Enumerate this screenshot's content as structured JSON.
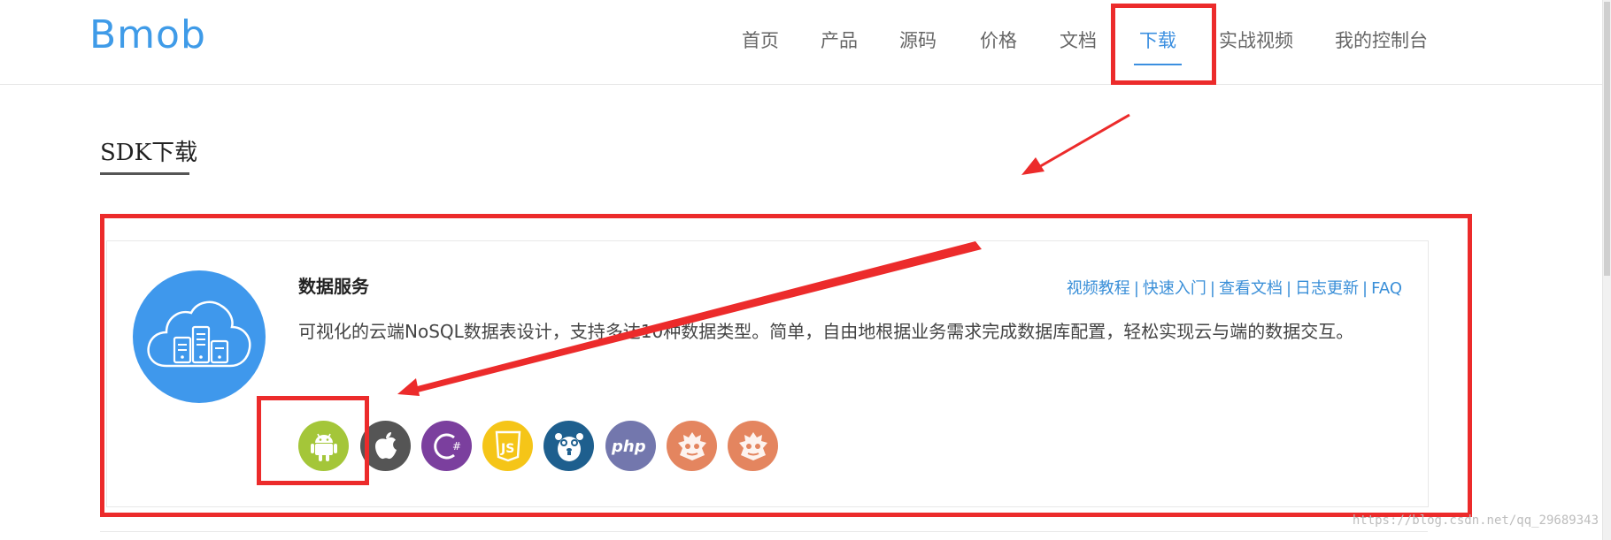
{
  "header": {
    "logo": "Bmob",
    "nav": [
      {
        "label": "首页",
        "active": false
      },
      {
        "label": "产品",
        "active": false
      },
      {
        "label": "源码",
        "active": false
      },
      {
        "label": "价格",
        "active": false
      },
      {
        "label": "文档",
        "active": false
      },
      {
        "label": "下载",
        "active": true
      },
      {
        "label": "实战视频",
        "active": false
      },
      {
        "label": "我的控制台",
        "active": false
      }
    ]
  },
  "section": {
    "title": "SDK下载"
  },
  "card": {
    "title": "数据服务",
    "links": [
      "视频教程",
      "快速入门",
      "查看文档",
      "日志更新",
      "FAQ"
    ],
    "link_separator": "|",
    "description": "可视化的云端NoSQL数据表设计，支持多达10种数据类型。简单，自由地根据业务需求完成数据库配置，轻松实现云与端的数据交互。",
    "service_icon": "cloud-server-icon",
    "platforms": [
      {
        "name": "android-icon",
        "color": "#a4c639"
      },
      {
        "name": "apple-icon",
        "color": "#555555"
      },
      {
        "name": "csharp-icon",
        "color": "#7b3f9e"
      },
      {
        "name": "javascript-icon",
        "color": "#f5c518"
      },
      {
        "name": "go-icon",
        "color": "#1e5f8e"
      },
      {
        "name": "php-icon",
        "color": "#7377ad"
      },
      {
        "name": "cocos-icon",
        "color": "#e4855f"
      },
      {
        "name": "cocos-js-icon",
        "color": "#e4855f"
      }
    ]
  },
  "watermark": "https://blog.csdn.net/qq_29689343",
  "colors": {
    "accent": "#3b8fe0",
    "annotation": "#ec2b2b"
  }
}
